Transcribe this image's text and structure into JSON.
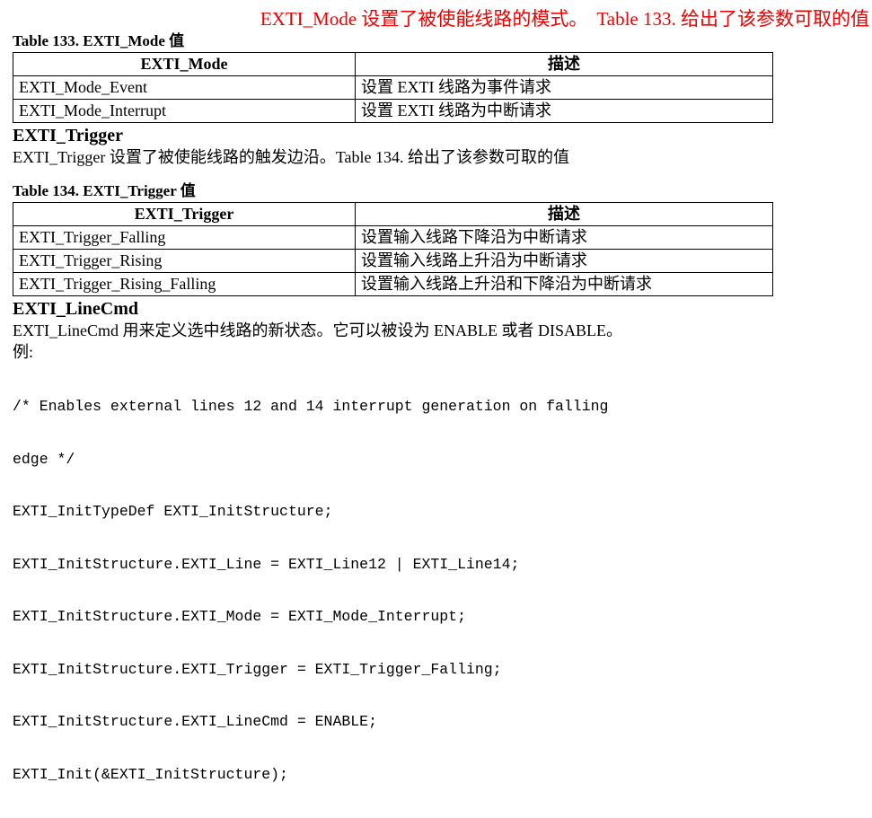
{
  "intro": {
    "red_color": "#ee0000",
    "part1": "EXTI_Mode 设置了被使能线路的模式。",
    "part2": "Table 133. 给出了该参数可取的值"
  },
  "table133": {
    "caption": "Table 133. EXTI_Mode 值",
    "headers": [
      "EXTI_Mode",
      "描述"
    ],
    "rows": [
      [
        "EXTI_Mode_Event",
        "设置 EXTI 线路为事件请求"
      ],
      [
        "EXTI_Mode_Interrupt",
        "设置 EXTI 线路为中断请求"
      ]
    ]
  },
  "section_trigger": {
    "heading": "EXTI_Trigger",
    "paragraph": "EXTI_Trigger 设置了被使能线路的触发边沿。Table 134. 给出了该参数可取的值"
  },
  "table134": {
    "caption": "Table 134. EXTI_Trigger 值",
    "headers": [
      "EXTI_Trigger",
      "描述"
    ],
    "rows": [
      [
        "EXTI_Trigger_Falling",
        "设置输入线路下降沿为中断请求"
      ],
      [
        "EXTI_Trigger_Rising",
        "设置输入线路上升沿为中断请求"
      ],
      [
        "EXTI_Trigger_Rising_Falling",
        "设置输入线路上升沿和下降沿为中断请求"
      ]
    ]
  },
  "section_linecmd": {
    "heading": "EXTI_LineCmd",
    "paragraph": "EXTI_LineCmd 用来定义选中线路的新状态。它可以被设为 ENABLE 或者 DISABLE。",
    "example_label": "例:"
  },
  "code": {
    "lines": [
      "/* Enables external lines 12 and 14 interrupt generation on falling",
      "edge */",
      "EXTI_InitTypeDef EXTI_InitStructure;",
      "EXTI_InitStructure.EXTI_Line = EXTI_Line12 | EXTI_Line14;",
      "EXTI_InitStructure.EXTI_Mode = EXTI_Mode_Interrupt;",
      "EXTI_InitStructure.EXTI_Trigger = EXTI_Trigger_Falling;",
      "EXTI_InitStructure.EXTI_LineCmd = ENABLE;",
      "EXTI_Init(&EXTI_InitStructure);"
    ]
  }
}
